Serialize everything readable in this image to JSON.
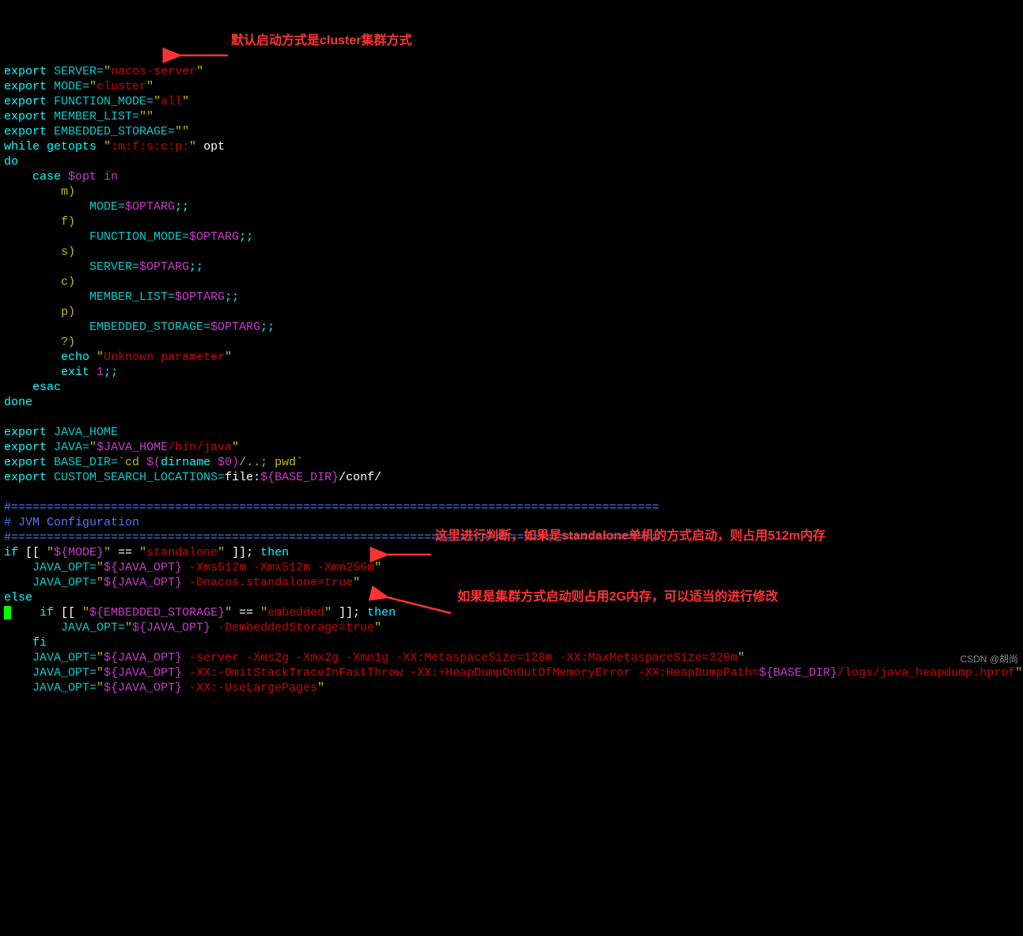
{
  "code": {
    "l1_a": "export",
    "l1_b": "SERVER=",
    "l1_c": "\"",
    "l1_d": "nacos-server",
    "l1_e": "\"",
    "l2_a": "export",
    "l2_b": "MODE=",
    "l2_c": "\"",
    "l2_d": "cluster",
    "l2_e": "\"",
    "l3_a": "export",
    "l3_b": "FUNCTION_MODE=",
    "l3_c": "\"",
    "l3_d": "all",
    "l3_e": "\"",
    "l4_a": "export",
    "l4_b": "MEMBER_LIST=",
    "l4_c": "\"\"",
    "l5_a": "export",
    "l5_b": "EMBEDDED_STORAGE=",
    "l5_c": "\"\"",
    "l6_a": "while",
    "l6_b": "getopts",
    "l6_c": "\"",
    "l6_d": ":m:f:s:c:p:",
    "l6_e": "\"",
    "l6_f": "opt",
    "l7": "do",
    "l8_a": "    case",
    "l8_b": "$opt in",
    "l9": "        m)",
    "l10_a": "            MODE=",
    "l10_b": "$OPTARG",
    "l10_c": ";;",
    "l11": "        f)",
    "l12_a": "            FUNCTION_MODE=",
    "l12_b": "$OPTARG",
    "l12_c": ";;",
    "l13": "        s)",
    "l14_a": "            SERVER=",
    "l14_b": "$OPTARG",
    "l14_c": ";;",
    "l15": "        c)",
    "l16_a": "            MEMBER_LIST=",
    "l16_b": "$OPTARG",
    "l16_c": ";;",
    "l17": "        p)",
    "l18_a": "            EMBEDDED_STORAGE=",
    "l18_b": "$OPTARG",
    "l18_c": ";;",
    "l19": "        ?)",
    "l20_a": "        echo",
    "l20_b": "\"",
    "l20_c": "Unknown parameter",
    "l20_d": "\"",
    "l21_a": "        exit",
    "l21_b": "1",
    "l21_c": ";;",
    "l22": "    esac",
    "l23": "done",
    "l25_a": "export",
    "l25_b": "JAVA_HOME",
    "l26_a": "export",
    "l26_b": "JAVA=",
    "l26_c": "\"",
    "l26_d": "$JAVA_HOME",
    "l26_e": "/bin/java",
    "l26_f": "\"",
    "l27_a": "export",
    "l27_b": "BASE_DIR=",
    "l27_c": "`cd ",
    "l27_d": "$(",
    "l27_e": "dirname ",
    "l27_f": "$0",
    "l27_g": ")",
    "l27_h": "/..; pwd`",
    "l28_a": "export",
    "l28_b": "CUSTOM_SEARCH_LOCATIONS=",
    "l28_c": "file:",
    "l28_d": "${BASE_DIR}",
    "l28_e": "/conf/",
    "l30": "#===========================================================================================",
    "l31": "# JVM Configuration",
    "l32": "#===========================================================================================",
    "l33_a": "if",
    "l33_b": " [[ ",
    "l33_c": "\"",
    "l33_d": "${MODE}",
    "l33_e": "\"",
    "l33_f": " == ",
    "l33_g": "\"",
    "l33_h": "standalone",
    "l33_i": "\"",
    "l33_j": " ]]; ",
    "l33_k": "then",
    "l34_a": "    JAVA_OPT=",
    "l34_b": "\"",
    "l34_c": "${JAVA_OPT}",
    "l34_d": " -Xms512m -Xmx512m -Xmn256m",
    "l34_e": "\"",
    "l35_a": "    JAVA_OPT=",
    "l35_b": "\"",
    "l35_c": "${JAVA_OPT}",
    "l35_d": " -Dnacos.standalone=true",
    "l35_e": "\"",
    "l36": "else",
    "l37_a": "    if",
    "l37_b": " [[ ",
    "l37_c": "\"",
    "l37_d": "${EMBEDDED_STORAGE}",
    "l37_e": "\"",
    "l37_f": " == ",
    "l37_g": "\"",
    "l37_h": "embedded",
    "l37_i": "\"",
    "l37_j": " ]]; ",
    "l37_k": "then",
    "l38_a": "        JAVA_OPT=",
    "l38_b": "\"",
    "l38_c": "${JAVA_OPT}",
    "l38_d": " -DembeddedStorage=true",
    "l38_e": "\"",
    "l39": "    fi",
    "l40_a": "    JAVA_OPT=",
    "l40_b": "\"",
    "l40_c": "${JAVA_OPT}",
    "l40_d": " -server -Xms2g -Xmx2g -Xmn1g -XX:MetaspaceSize=128m -XX:MaxMetaspaceSize=320m",
    "l40_e": "\"",
    "l41_a": "    JAVA_OPT=",
    "l41_b": "\"",
    "l41_c": "${JAVA_OPT}",
    "l41_d": " -XX:-OmitStackTraceInFastThrow -XX:+HeapDumpOnOutOfMemoryError -XX:HeapDumpPath=",
    "l41_e": "${BASE_DIR}",
    "l41_f": "/logs/java_heapdump.hprof",
    "l41_g": "\"",
    "l42_a": "    JAVA_OPT=",
    "l42_b": "\"",
    "l42_c": "${JAVA_OPT}",
    "l42_d": " -XX:-UseLargePages",
    "l42_e": "\""
  },
  "annotations": {
    "a1": "默认启动方式是cluster集群方式",
    "a2": "这里进行判断，如果是standalone单机的方式启动，则占用512m内存",
    "a3": "如果是集群方式启动则占用2G内存，可以适当的进行修改"
  },
  "watermark": "CSDN @胡尚"
}
